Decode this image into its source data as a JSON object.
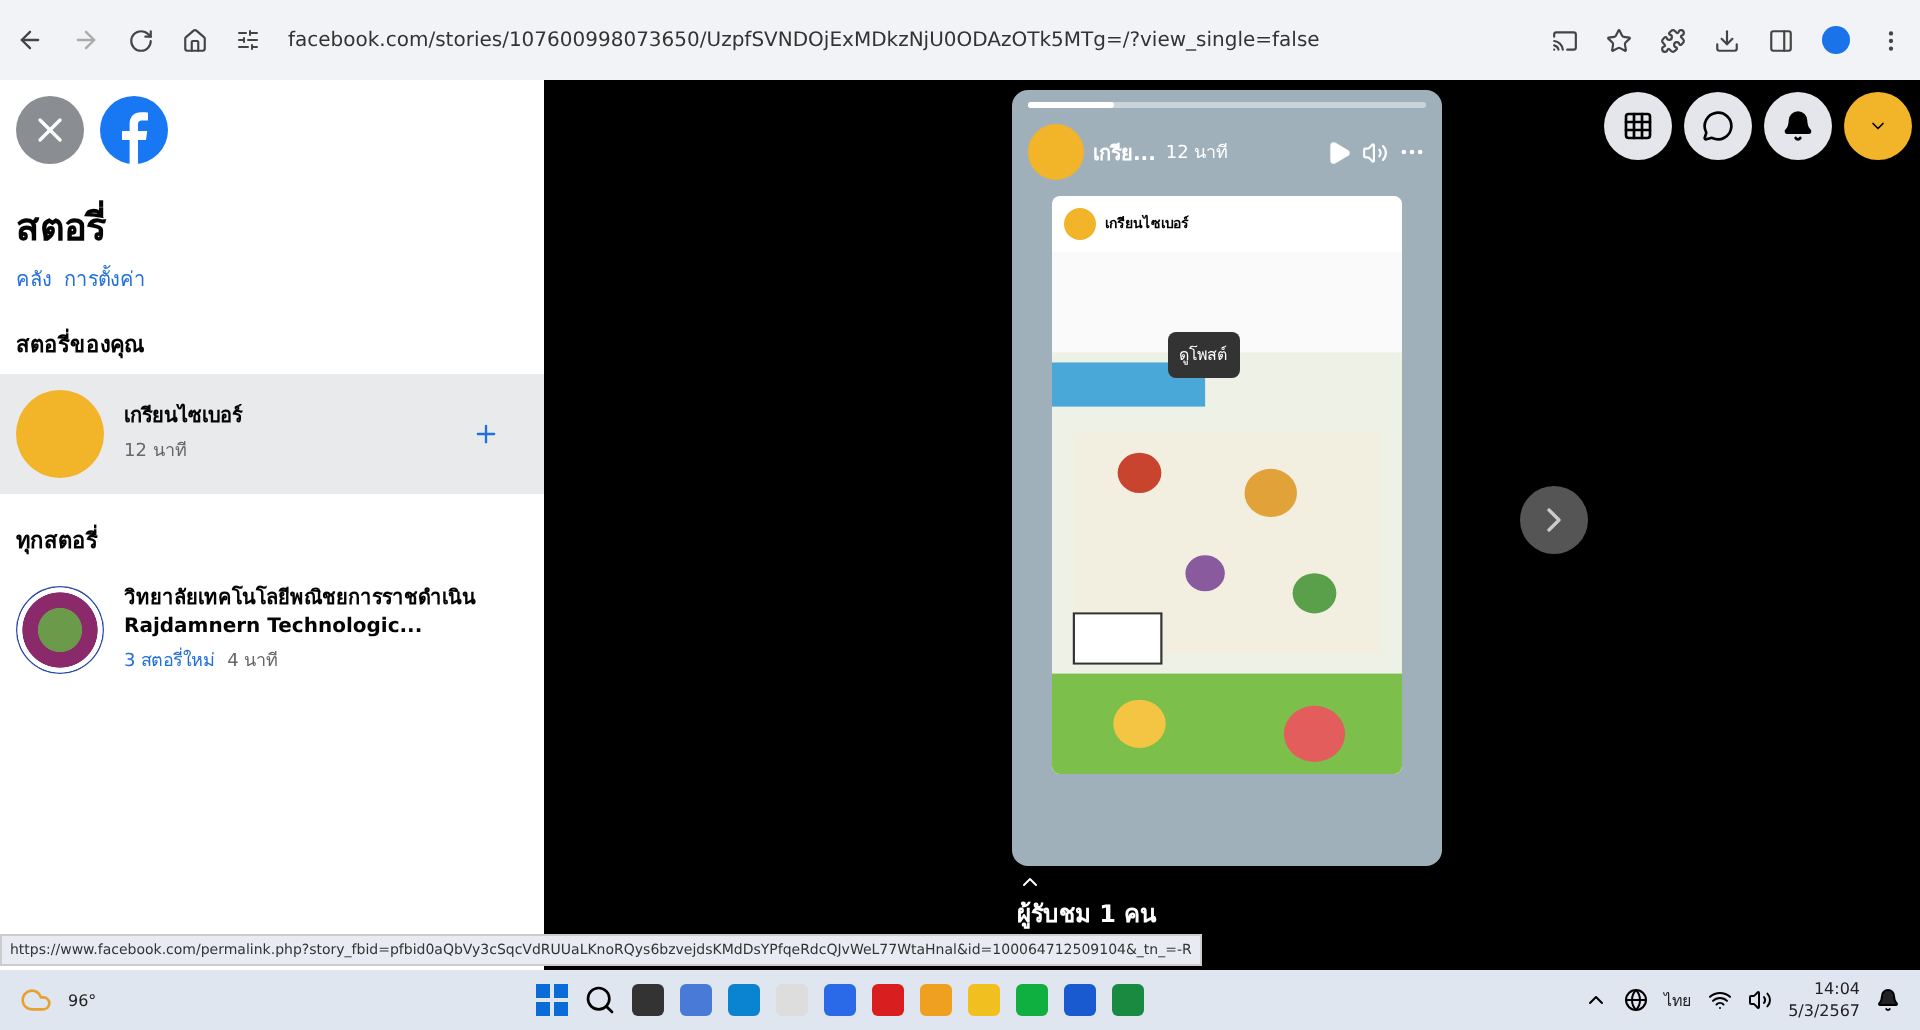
{
  "browser": {
    "url": "facebook.com/stories/107600998073650/UzpfSVNDOjExMDkzNjU0ODAzOTk5MTg=/?view_single=false"
  },
  "sidebar": {
    "title": "สตอรี่",
    "links": [
      "คลัง",
      "การตั้งค่า"
    ],
    "your_stories_heading": "สตอรี่ของคุณ",
    "your_story": {
      "name": "เกรียนไซเบอร์",
      "time": "12 นาที",
      "selected": true
    },
    "all_stories_heading": "ทุกสตอรี่",
    "stories": [
      {
        "name": "วิทยาลัยเทคโนโลยีพณิชยการราชดำเนิน Rajdamnern Technologic...",
        "new_count": "3 สตอรี่ใหม่",
        "time": "4 นาที"
      }
    ]
  },
  "story": {
    "author": "เกรีย...",
    "time": "12 นาที",
    "post_author": "เกรียนไซเบอร์",
    "tooltip": "ดูโพสต์",
    "progress": {
      "level": 0.22
    },
    "viewers": "ผู้รับชม 1 คน"
  },
  "status_url": "https://www.facebook.com/permalink.php?story_fbid=pfbid0aQbVy3cSqcVdRUUaLKnoRQys6bzvejdsKMdDsYPfqeRdcQJvWeL77WtaHnal&id=100064712509104&_tn_=-R",
  "taskbar": {
    "weather": "96°",
    "language": "ไทย",
    "time": "14:04",
    "date": "5/3/2567"
  }
}
